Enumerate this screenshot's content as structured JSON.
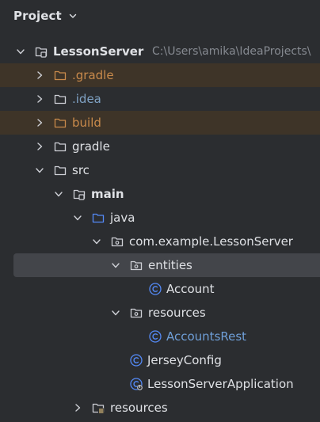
{
  "panel": {
    "title": "Project",
    "chevron_icon": "chevron-down-icon"
  },
  "colors": {
    "background": "#2b2d30",
    "text": "#dfe1e5",
    "excluded_highlight": "#3e3428",
    "selection": "#43454a",
    "excluded_text": "#c98a4b",
    "class_icon": "#548af7",
    "hint_text": "#868a91"
  },
  "tree": [
    {
      "label": "LessonServer",
      "path": "C:\\Users\\amika\\IdeaProjects\\",
      "expanded": true,
      "icon": "module-folder-icon",
      "bold": true
    },
    {
      "label": ".gradle",
      "expanded": false,
      "icon": "excluded-folder-icon",
      "excluded": true
    },
    {
      "label": ".idea",
      "expanded": false,
      "icon": "folder-icon"
    },
    {
      "label": "build",
      "expanded": false,
      "icon": "excluded-folder-icon",
      "excluded": true
    },
    {
      "label": "gradle",
      "expanded": false,
      "icon": "folder-icon"
    },
    {
      "label": "src",
      "expanded": true,
      "icon": "folder-icon"
    },
    {
      "label": "main",
      "expanded": true,
      "icon": "module-folder-icon",
      "bold": true
    },
    {
      "label": "java",
      "expanded": true,
      "icon": "source-root-folder-icon"
    },
    {
      "label": "com.example.LessonServer",
      "expanded": true,
      "icon": "package-icon"
    },
    {
      "label": "entities",
      "expanded": true,
      "icon": "package-icon",
      "selected": true
    },
    {
      "label": "Account",
      "icon": "class-icon"
    },
    {
      "label": "resources",
      "expanded": true,
      "icon": "package-icon"
    },
    {
      "label": "AccountsRest",
      "icon": "class-icon"
    },
    {
      "label": "JerseyConfig",
      "icon": "class-icon"
    },
    {
      "label": "LessonServerApplication",
      "icon": "spring-boot-class-icon"
    },
    {
      "label": "resources",
      "expanded": false,
      "icon": "resources-root-folder-icon"
    }
  ]
}
